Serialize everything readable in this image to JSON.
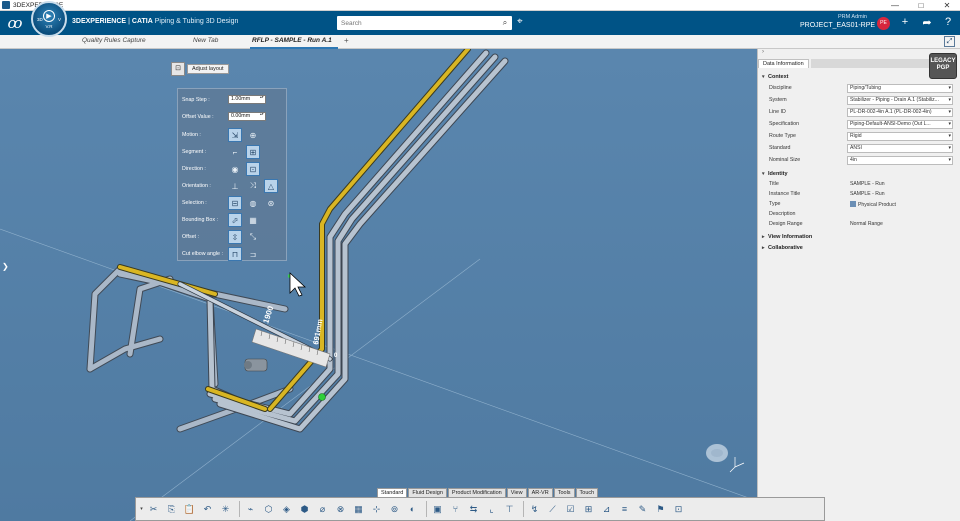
{
  "os_bar": {
    "title": "3DEXPERIENCE",
    "controls": [
      "—",
      "□",
      "✕"
    ]
  },
  "header": {
    "brand_bold": "3DEXPERIENCE",
    "brand_sep": "|",
    "brand_app": "CATIA",
    "brand_product": "Piping & Tubing 3D Design",
    "compass_left": "3D",
    "compass_right": "V",
    "compass_version": "V.R",
    "compass_play": "▶",
    "search_placeholder": "Search",
    "user_role": "PRM Admin",
    "project": "PROJECT_EAS01-RPE",
    "avatar_initials": "PE",
    "icons": [
      "plus-icon",
      "share-icon",
      "help-icon"
    ]
  },
  "tabs": [
    {
      "label": "Quality Rules Capture",
      "active": false
    },
    {
      "label": "New Tab",
      "active": false
    },
    {
      "label": "RFLP - SAMPLE - Run A.1",
      "active": true
    }
  ],
  "tab_add": "+",
  "tab_expand": "⤢",
  "viewport": {
    "dimension_1900": "1900",
    "dimension_691": "691mm",
    "dimension_0": "0"
  },
  "adjust_layout": {
    "header_label": "Adjust layout",
    "header_icon": "⊡",
    "snap_step_label": "Snap Step :",
    "snap_step_value": "1.00mm",
    "offset_value_label": "Offset Value :",
    "offset_value_value": "0.00mm",
    "rows": [
      {
        "label": "Motion :",
        "icons": [
          {
            "glyph": "⇲",
            "on": true
          },
          {
            "glyph": "⊕",
            "on": false
          }
        ]
      },
      {
        "label": "Segment :",
        "icons": [
          {
            "glyph": "⌐",
            "on": false
          },
          {
            "glyph": "⊞",
            "on": true
          }
        ]
      },
      {
        "label": "Direction :",
        "icons": [
          {
            "glyph": "◉",
            "on": false
          },
          {
            "glyph": "⊡",
            "on": true
          }
        ]
      },
      {
        "label": "Orientation :",
        "icons": [
          {
            "glyph": "⊥",
            "on": false
          },
          {
            "glyph": "⤨",
            "on": false
          },
          {
            "glyph": "△",
            "on": true
          }
        ]
      },
      {
        "label": "Selection :",
        "icons": [
          {
            "glyph": "⊟",
            "on": true
          },
          {
            "glyph": "◍",
            "on": false
          },
          {
            "glyph": "⊛",
            "on": false
          }
        ]
      },
      {
        "label": "Bounding Box :",
        "icons": [
          {
            "glyph": "⬀",
            "on": true
          },
          {
            "glyph": "▦",
            "on": false
          }
        ]
      },
      {
        "label": "Offset :",
        "icons": [
          {
            "glyph": "⇳",
            "on": true
          },
          {
            "glyph": "⤡",
            "on": false
          }
        ]
      },
      {
        "label": "Cut elbow angle :",
        "icons": [
          {
            "glyph": "⊓",
            "on": true
          },
          {
            "glyph": "⊐",
            "on": false
          }
        ]
      }
    ]
  },
  "right_panel": {
    "top_arrow": "›",
    "tab_label": "Data Information",
    "legacy_line1": "LEGACY",
    "legacy_line2": "PGP",
    "context": {
      "title": "Context",
      "props": [
        {
          "label": "Discipline",
          "value": "Piping/Tubing"
        },
        {
          "label": "System",
          "value": "Stabilizer - Piping - Drain A.1 (Stabiliz..."
        },
        {
          "label": "Line ID",
          "value": "PL-DR-002-4in A.1 (PL-DR-002-4in)"
        },
        {
          "label": "Specification",
          "value": "Piping-Default-ANSI-Demo (Out L..."
        },
        {
          "label": "Route Type",
          "value": "Rigid"
        },
        {
          "label": "Standard",
          "value": "ANSI"
        },
        {
          "label": "Nominal Size",
          "value": "4in"
        }
      ]
    },
    "identity": {
      "title": "Identity",
      "props": [
        {
          "label": "Title",
          "value": "SAMPLE - Run"
        },
        {
          "label": "Instance Title",
          "value": "SAMPLE - Run"
        },
        {
          "label": "Type",
          "value": "Physical Product"
        },
        {
          "label": "Description",
          "value": ""
        },
        {
          "label": "Design Range",
          "value": "Normal Range"
        }
      ]
    },
    "view_information": "View Information",
    "collaborative": "Collaborative"
  },
  "action_bar": {
    "tabs": [
      {
        "label": "Standard",
        "active": true
      },
      {
        "label": "Fluid Design",
        "active": false
      },
      {
        "label": "Product Modification",
        "active": false
      },
      {
        "label": "View",
        "active": false
      },
      {
        "label": "AR-VR",
        "active": false
      },
      {
        "label": "Tools",
        "active": false
      },
      {
        "label": "Touch",
        "active": false
      }
    ],
    "tools": [
      {
        "name": "more-icon",
        "glyph": "▾"
      },
      {
        "name": "cut-icon",
        "glyph": "✂"
      },
      {
        "name": "copy-icon",
        "glyph": "⎘"
      },
      {
        "name": "paste-icon",
        "glyph": "📋"
      },
      {
        "name": "undo-icon",
        "glyph": "↶"
      },
      {
        "name": "settings-icon",
        "glyph": "✳"
      },
      {
        "sep": true
      },
      {
        "name": "route-icon",
        "glyph": "⌁"
      },
      {
        "name": "box-icon",
        "glyph": "⬡"
      },
      {
        "name": "cube-icon",
        "glyph": "◈"
      },
      {
        "name": "part-icon",
        "glyph": "⬢"
      },
      {
        "name": "pipe-icon",
        "glyph": "⌀"
      },
      {
        "name": "valve-icon",
        "glyph": "⊗"
      },
      {
        "name": "grid-icon",
        "glyph": "▦"
      },
      {
        "name": "network-icon",
        "glyph": "⊹"
      },
      {
        "name": "pin-icon",
        "glyph": "⊚"
      },
      {
        "name": "flange-icon",
        "glyph": "◐"
      },
      {
        "sep": true
      },
      {
        "name": "folder-icon",
        "glyph": "▣"
      },
      {
        "name": "branch-icon",
        "glyph": "⑂"
      },
      {
        "name": "connect-icon",
        "glyph": "⇆"
      },
      {
        "name": "elbow-icon",
        "glyph": "⌞"
      },
      {
        "name": "tee-icon",
        "glyph": "⊤"
      },
      {
        "sep": true
      },
      {
        "name": "bend-icon",
        "glyph": "↯"
      },
      {
        "name": "slope-icon",
        "glyph": "⟋"
      },
      {
        "name": "check-icon",
        "glyph": "☑"
      },
      {
        "name": "table-icon",
        "glyph": "⊞"
      },
      {
        "name": "measure-icon",
        "glyph": "⊿"
      },
      {
        "name": "layers-icon",
        "glyph": "≡"
      },
      {
        "name": "pencil-icon",
        "glyph": "✎"
      },
      {
        "name": "flag-icon",
        "glyph": "⚑"
      },
      {
        "name": "lock-icon",
        "glyph": "⊡"
      }
    ]
  }
}
